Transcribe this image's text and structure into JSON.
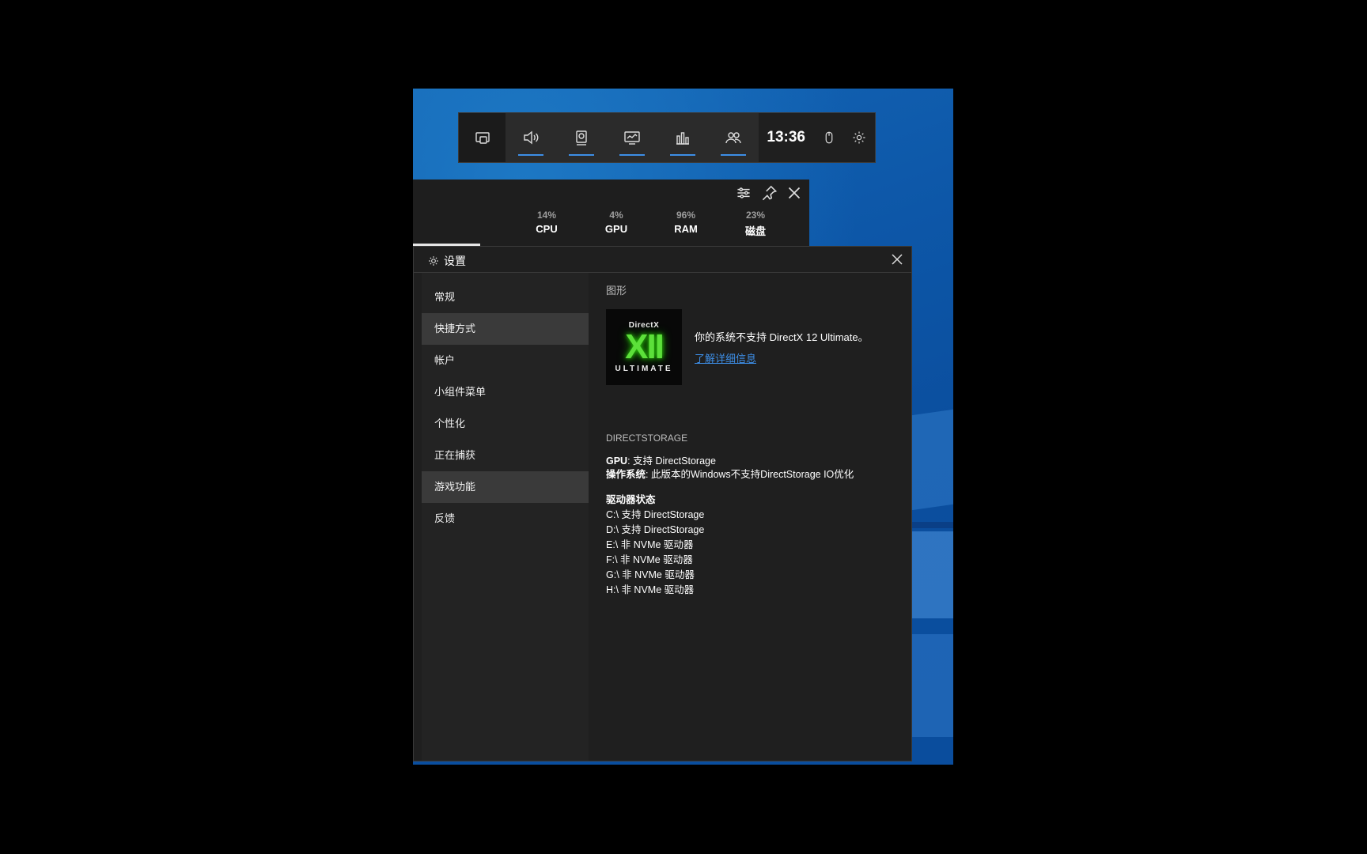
{
  "gamebar": {
    "time": "13:36",
    "widgets": [
      "audio-icon",
      "capture-icon",
      "performance-icon",
      "stats-icon",
      "social-icon"
    ]
  },
  "performance": {
    "metrics": [
      {
        "pct": "14%",
        "label": "CPU"
      },
      {
        "pct": "4%",
        "label": "GPU"
      },
      {
        "pct": "96%",
        "label": "RAM"
      },
      {
        "pct": "23%",
        "label": "磁盘"
      }
    ]
  },
  "settings": {
    "title": "设置",
    "nav": [
      "常规",
      "快捷方式",
      "帐户",
      "小组件菜单",
      "个性化",
      "正在捕获",
      "游戏功能",
      "反馈"
    ],
    "selected_index": 6,
    "hover_index": 1,
    "graphics_label": "图形",
    "dx_logo": {
      "top": "DirectX",
      "mid": "XII",
      "bottom": "ULTIMATE"
    },
    "dx_message": "你的系统不支持 DirectX 12 Ultimate。",
    "dx_link": "了解详细信息",
    "directstorage_label": "DIRECTSTORAGE",
    "gpu_key": "GPU",
    "gpu_value": ": 支持 DirectStorage",
    "os_key": "操作系统",
    "os_value": ": 此版本的Windows不支持DirectStorage IO优化",
    "drive_header": "驱动器状态",
    "drives": [
      "C:\\ 支持 DirectStorage",
      "D:\\ 支持 DirectStorage",
      "E:\\ 非 NVMe 驱动器",
      "F:\\ 非 NVMe 驱动器",
      "G:\\ 非 NVMe 驱动器",
      "H:\\ 非 NVMe 驱动器"
    ]
  },
  "colors": {
    "accent": "#3d8ee6",
    "panel": "#1f1f1f",
    "desktop": "#0d57a8"
  }
}
